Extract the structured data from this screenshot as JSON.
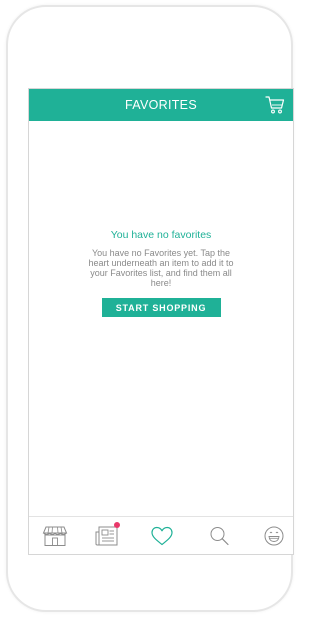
{
  "header": {
    "title": "FAVORITES",
    "cart_icon": "cart-icon"
  },
  "empty_state": {
    "title": "You have no favorites",
    "body": "You have no Favorites yet. Tap the heart underneath an item to add it to your Favorites list, and find them all here!",
    "button_label": "START SHOPPING"
  },
  "tab_bar": {
    "items": [
      {
        "icon": "store-icon",
        "active": false
      },
      {
        "icon": "newspaper-icon",
        "active": false,
        "badge": true
      },
      {
        "icon": "heart-icon",
        "active": true
      },
      {
        "icon": "search-icon",
        "active": false
      },
      {
        "icon": "smiley-icon",
        "active": false
      }
    ]
  },
  "colors": {
    "accent": "#1fb197",
    "badge": "#e9386a",
    "icon_inactive": "#8c8c8c",
    "body_text": "#8a8a8a"
  }
}
